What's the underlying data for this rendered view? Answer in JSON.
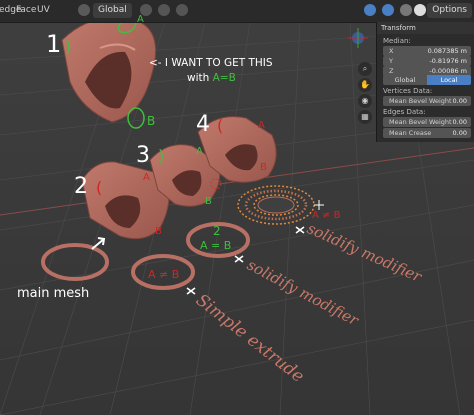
{
  "header": {
    "menus": [
      "edge",
      "Face",
      "UV"
    ],
    "orientation": "Global",
    "options_label": "Options"
  },
  "npanel": {
    "title": "Transform",
    "median_label": "Median:",
    "x_label": "X",
    "x_value": "0.087385 m",
    "y_label": "Y",
    "y_value": "-0.81976 m",
    "z_label": "Z",
    "z_value": "-0.00086 m",
    "global_label": "Global",
    "local_label": "Local",
    "vertices_data_label": "Vertices Data:",
    "mean_bevel_weight_label": "Mean Bevel Weight",
    "mean_bevel_weight_value": "0.00",
    "edges_data_label": "Edges Data:",
    "edges_bevel_label": "Mean Bevel Weight",
    "edges_bevel_value": "0.00",
    "mean_crease_label": "Mean Crease",
    "mean_crease_value": "0.00"
  },
  "annotations": {
    "n1": "1",
    "want_text": "<- I WANT TO GET THIS",
    "with_text": "with",
    "ab_equal": "A=B",
    "label_a": "A",
    "label_b": "B",
    "n2": "2",
    "n3": "3",
    "n4": "4",
    "two_label": "2",
    "a_eq_b": "A = B",
    "a_neq_b": "A ≠ B",
    "main_mesh": "main mesh",
    "simple_extrude": "Simple extrude",
    "solidify_modifier": "solidify modifier"
  },
  "colors": {
    "mesh_fill": "#b87064",
    "mesh_dark": "#7e443c",
    "annot_green": "#3fbf3f",
    "annot_red": "#d42424",
    "annot_white": "#ffffff",
    "curvy_text": "#c87868",
    "accent_blue": "#4a7fc4"
  }
}
